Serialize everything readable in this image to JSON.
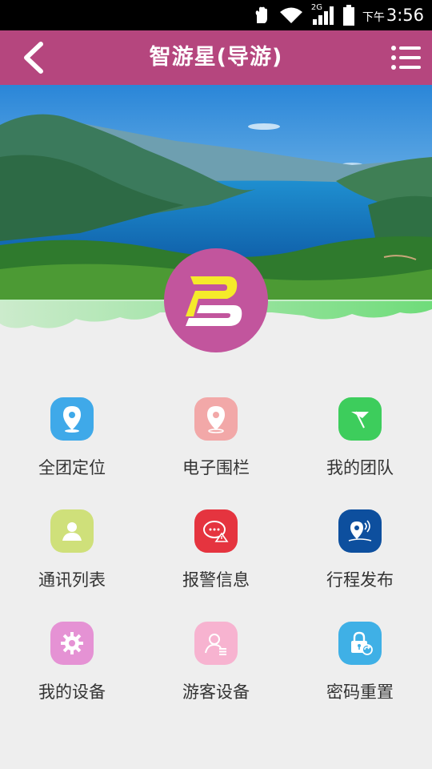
{
  "status_bar": {
    "network": "2G",
    "time_prefix": "下午",
    "time": "3:56"
  },
  "app_bar": {
    "title": "智游星(导游)",
    "back_icon": "chevron-left-icon",
    "menu_icon": "list-menu-icon",
    "color": "#b5467e"
  },
  "banner": {
    "image": "mountain-lake-landscape"
  },
  "logo": {
    "icon": "b-logo-icon",
    "color": "#c2559d"
  },
  "menu": [
    {
      "label": "全团定位",
      "icon": "location-pin-icon",
      "color": "#3fa9e9"
    },
    {
      "label": "电子围栏",
      "icon": "fence-pin-icon",
      "color": "#f2a8a8"
    },
    {
      "label": "我的团队",
      "icon": "team-flag-icon",
      "color": "#3dcd5c"
    },
    {
      "label": "通讯列表",
      "icon": "contact-person-icon",
      "color": "#cfe07a"
    },
    {
      "label": "报警信息",
      "icon": "alarm-message-icon",
      "color": "#e5343f"
    },
    {
      "label": "行程发布",
      "icon": "itinerary-broadcast-icon",
      "color": "#0d4f9e"
    },
    {
      "label": "我的设备",
      "icon": "gear-icon",
      "color": "#e592d4"
    },
    {
      "label": "游客设备",
      "icon": "tourist-device-icon",
      "color": "#f7b3d0"
    },
    {
      "label": "密码重置",
      "icon": "lock-reset-icon",
      "color": "#3fb0e6"
    }
  ]
}
